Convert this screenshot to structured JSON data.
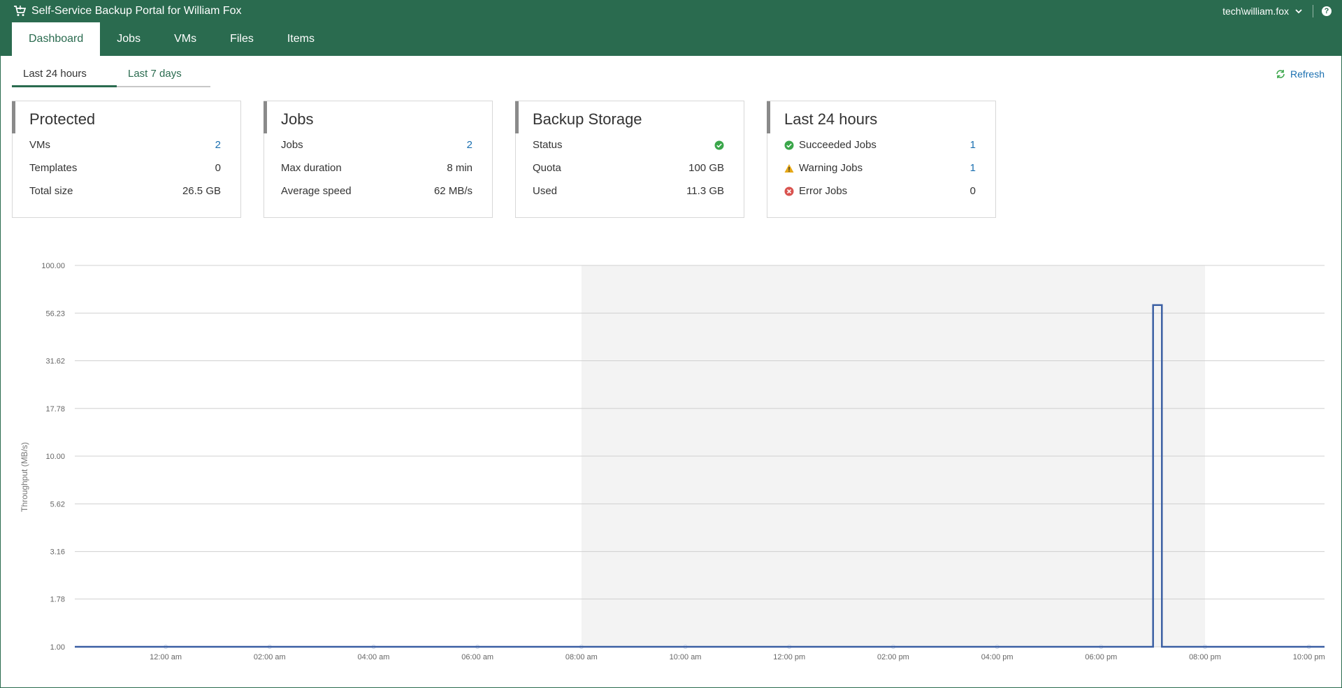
{
  "header": {
    "title": "Self-Service Backup Portal for William Fox",
    "user": "tech\\william.fox",
    "help": "?"
  },
  "nav": {
    "tabs": [
      {
        "label": "Dashboard",
        "active": true
      },
      {
        "label": "Jobs",
        "active": false
      },
      {
        "label": "VMs",
        "active": false
      },
      {
        "label": "Files",
        "active": false
      },
      {
        "label": "Items",
        "active": false
      }
    ]
  },
  "period_tabs": [
    {
      "label": "Last 24 hours",
      "active": true
    },
    {
      "label": "Last 7 days",
      "active": false
    }
  ],
  "refresh_label": "Refresh",
  "cards": {
    "protected": {
      "title": "Protected",
      "rows": [
        {
          "label": "VMs",
          "value": "2"
        },
        {
          "label": "Templates",
          "value": "0"
        },
        {
          "label": "Total size",
          "value": "26.5 GB"
        }
      ]
    },
    "jobs": {
      "title": "Jobs",
      "rows": [
        {
          "label": "Jobs",
          "value": "2"
        },
        {
          "label": "Max duration",
          "value": "8 min"
        },
        {
          "label": "Average speed",
          "value": "62 MB/s"
        }
      ]
    },
    "storage": {
      "title": "Backup Storage",
      "rows": [
        {
          "label": "Status",
          "value": ""
        },
        {
          "label": "Quota",
          "value": "100 GB"
        },
        {
          "label": "Used",
          "value": "11.3 GB"
        }
      ]
    },
    "last24": {
      "title": "Last 24 hours",
      "rows": [
        {
          "label": "Succeeded Jobs",
          "value": "1"
        },
        {
          "label": "Warning Jobs",
          "value": "1"
        },
        {
          "label": "Error Jobs",
          "value": "0"
        }
      ]
    }
  },
  "colors": {
    "brand": "#2a6b4f",
    "link": "#1a6fb0",
    "success": "#3aa64a",
    "warning": "#e6a817",
    "error": "#d9534f",
    "series": "#3b5fa3"
  },
  "chart_data": {
    "type": "line",
    "ylabel": "Throughput (MB/s)",
    "yscale": "log",
    "ylim": [
      1,
      100
    ],
    "y_ticks": [
      "100.00",
      "56.23",
      "31.62",
      "17.78",
      "10.00",
      "5.62",
      "3.16",
      "1.78",
      "1.00"
    ],
    "x_ticks": [
      "12:00 am",
      "02:00 am",
      "04:00 am",
      "06:00 am",
      "08:00 am",
      "10:00 am",
      "12:00 pm",
      "02:00 pm",
      "04:00 pm",
      "06:00 pm",
      "08:00 pm",
      "10:00 pm"
    ],
    "x_range_hours": [
      -1.75,
      22.3
    ],
    "shaded_range_hours": [
      8,
      20
    ],
    "series": [
      {
        "points": [
          {
            "x": -1.75,
            "y": 1
          },
          {
            "x": 19.0,
            "y": 1
          },
          {
            "x": 19.0,
            "y": 62
          },
          {
            "x": 19.17,
            "y": 62
          },
          {
            "x": 19.17,
            "y": 1
          },
          {
            "x": 22.3,
            "y": 1
          }
        ]
      }
    ],
    "grid": true
  }
}
